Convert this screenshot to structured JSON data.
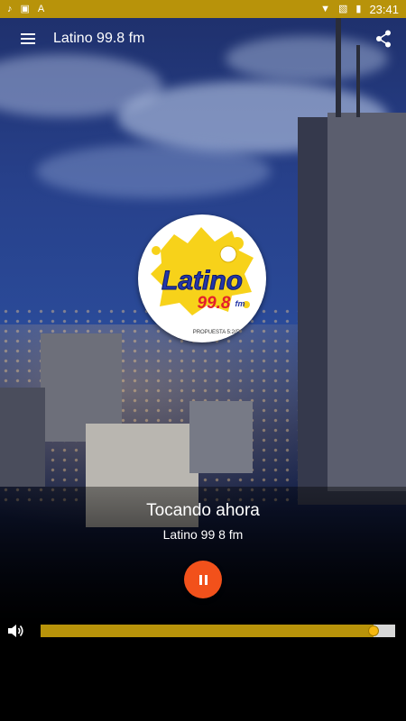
{
  "status_bar": {
    "time": "23:41",
    "left_icons": [
      "music-note-icon",
      "image-icon",
      "font-icon"
    ],
    "right_icons": [
      "wifi-icon",
      "no-sim-icon",
      "battery-icon"
    ],
    "color": "#b8930a"
  },
  "app_bar": {
    "title": "Latino 99.8 fm"
  },
  "logo": {
    "brand_text": "Latino",
    "frequency_text": "99.8",
    "fm_text": "fm",
    "tagline": "PROPUESTA 5:2(D)"
  },
  "player": {
    "now_playing_label": "Tocando ahora",
    "station_name": "Latino 99 8 fm",
    "state": "playing",
    "accent": "#f2511b"
  },
  "volume": {
    "level": 0.94,
    "fill_color": "#b8930a"
  }
}
